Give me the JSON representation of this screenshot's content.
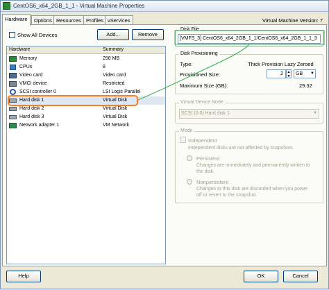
{
  "window": {
    "title": "CentOS6_x64_2GB_1_1 - Virtual Machine Properties"
  },
  "tabs": [
    {
      "label": "Hardware"
    },
    {
      "label": "Options"
    },
    {
      "label": "Resources"
    },
    {
      "label": "Profiles"
    },
    {
      "label": "vServices"
    }
  ],
  "vm_version": "Virtual Machine Version: 7",
  "toolbar": {
    "show_all_label": "Show All Devices",
    "add_label": "Add...",
    "remove_label": "Remove"
  },
  "hardware_list": {
    "header_hardware": "Hardware",
    "header_summary": "Summary",
    "rows": [
      {
        "name": "Memory",
        "summary": "256 MB",
        "icon": "memory-icon"
      },
      {
        "name": "CPUs",
        "summary": "8",
        "icon": "cpu-icon"
      },
      {
        "name": "Video card",
        "summary": "Video card",
        "icon": "video-card-icon"
      },
      {
        "name": "VMCI device",
        "summary": "Restricted",
        "icon": "vmci-icon"
      },
      {
        "name": "SCSI controller 0",
        "summary": "LSI Logic Parallel",
        "icon": "scsi-icon"
      },
      {
        "name": "Hard disk 1",
        "summary": "Virtual Disk",
        "icon": "hard-disk-icon"
      },
      {
        "name": "Hard disk 2",
        "summary": "Virtual Disk",
        "icon": "hard-disk-icon"
      },
      {
        "name": "Hard disk 3",
        "summary": "Virtual Disk",
        "icon": "hard-disk-icon"
      },
      {
        "name": "Network adapter 1",
        "summary": "VM Network",
        "icon": "network-adapter-icon"
      }
    ]
  },
  "disk_file": {
    "label": "Disk File",
    "value": "[VMFS_3] CentOS6_x64_2GB_1_1/CentOS6_x64_2GB_1_1_3"
  },
  "disk_provisioning": {
    "label": "Disk Provisioning",
    "type_label": "Type:",
    "type_value": "Thick Provision Lazy Zeroed",
    "size_label": "Provisioned Size:",
    "size_value": "2",
    "size_unit": "GB",
    "max_label": "Maximum Size (GB):",
    "max_value": "29.32"
  },
  "virtual_device_node": {
    "label": "Virtual Device Node",
    "value": "SCSI (0:0) Hard disk 1"
  },
  "mode": {
    "label": "Mode",
    "independent_label": "Independent",
    "independent_desc": "Independent disks are not affected by snapshots.",
    "persistent_label": "Persistent",
    "persistent_desc_1": "Changes are immediately and permanently written to",
    "persistent_desc_2": "the disk.",
    "nonpersistent_label": "Nonpersistent",
    "nonpersistent_desc_1": "Changes to this disk are discarded when you power",
    "nonpersistent_desc_2": "off or revert to the snapshot."
  },
  "footer": {
    "help_label": "Help",
    "ok_label": "OK",
    "cancel_label": "Cancel"
  },
  "colors": {
    "annotation_orange": "#ff7f1f",
    "annotation_green": "#2fb24a",
    "selection": "#dfe7f3"
  }
}
